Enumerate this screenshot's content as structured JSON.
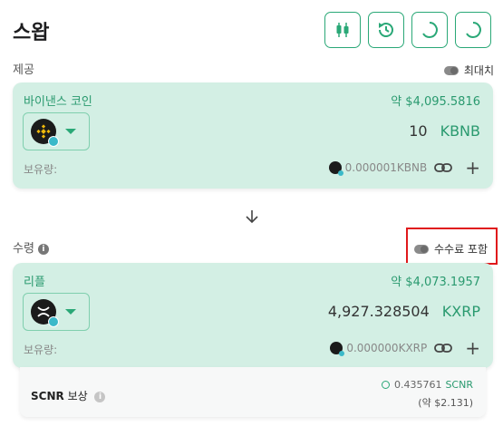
{
  "page": {
    "title": "스왑"
  },
  "toolbar": {
    "buttons": [
      {
        "icon": "candlestick-chart-icon"
      },
      {
        "icon": "history-icon"
      },
      {
        "icon": "refresh-loading-icon"
      },
      {
        "icon": "refresh-loading-icon"
      }
    ],
    "accent_color": "#2aa877"
  },
  "provide": {
    "label": "제공",
    "max_label": "최대치",
    "token_name": "바이낸스 코인",
    "usd_value": "약 $4,095.5816",
    "amount": "10",
    "unit": "KBNB",
    "balance_label": "보유량:",
    "balance_value": "0.000001KBNB"
  },
  "receive": {
    "label": "수령",
    "fee_label": "수수료 포함",
    "token_name": "리플",
    "usd_value": "약 $4,073.1957",
    "amount": "4,927.328504",
    "unit": "KXRP",
    "balance_label": "보유량:",
    "balance_value": "0.000000KXRP"
  },
  "reward": {
    "label_bold": "SCNR",
    "label": "보상",
    "amount": "0.435761",
    "unit": "SCNR",
    "usd": "(약 $2.131)"
  },
  "colors": {
    "card_bg": "#d3efe4",
    "accent_text": "#2a9a6f",
    "highlight_border": "#e0191b"
  }
}
